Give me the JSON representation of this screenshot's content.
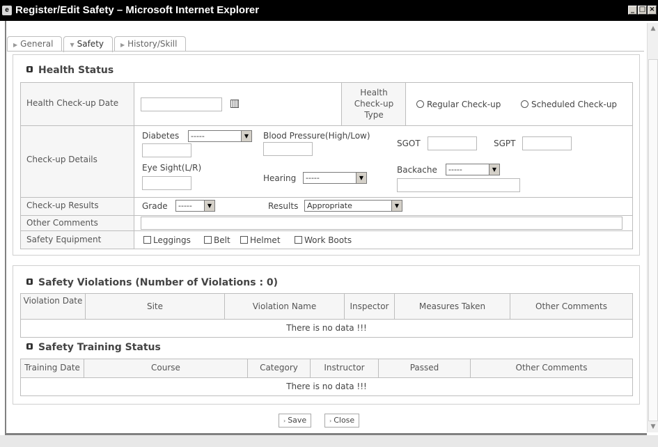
{
  "window": {
    "title": "Register/Edit Safety – Microsoft Internet Explorer",
    "min_glyph": "_",
    "max_glyph": "□",
    "close_glyph": "×"
  },
  "tabs": [
    {
      "label": "General"
    },
    {
      "label": "Safety"
    },
    {
      "label": "History/Skill"
    }
  ],
  "health": {
    "title": "Health Status",
    "checkup_date_label": "Health Check-up Date",
    "checkup_date_value": "",
    "checkup_type_label": "Health Check-up Type",
    "regular_label": "Regular Check-up",
    "scheduled_label": "Scheduled Check-up",
    "details_label": "Check-up Details",
    "diabetes_label": "Diabetes",
    "diabetes_value": "-----",
    "blood_pressure_label": "Blood Pressure(High/Low)",
    "sgot_label": "SGOT",
    "sgpt_label": "SGPT",
    "eye_sight_label": "Eye Sight(L/R)",
    "hearing_label": "Hearing",
    "hearing_value": "-----",
    "backache_label": "Backache",
    "backache_value": "-----",
    "results_label": "Check-up Results",
    "grade_label": "Grade",
    "grade_value": "-----",
    "results_field_label": "Results",
    "results_value": "Appropriate",
    "comments_label": "Other Comments",
    "equipment_label": "Safety Equipment",
    "equipment": [
      "Leggings",
      "Belt",
      "Helmet",
      "Work Boots"
    ]
  },
  "violations": {
    "title": "Safety Violations",
    "count_text": "(Number of Violations : 0)",
    "columns": [
      "Violation Date",
      "Site",
      "Violation Name",
      "Inspector",
      "Measures Taken",
      "Other Comments"
    ],
    "empty_text": "There is no data !!!"
  },
  "training": {
    "title": "Safety Training Status",
    "columns": [
      "Training Date",
      "Course",
      "Category",
      "Instructor",
      "Passed",
      "Other Comments"
    ],
    "empty_text": "There is no data !!!"
  },
  "buttons": {
    "save": "Save",
    "close": "Close"
  }
}
